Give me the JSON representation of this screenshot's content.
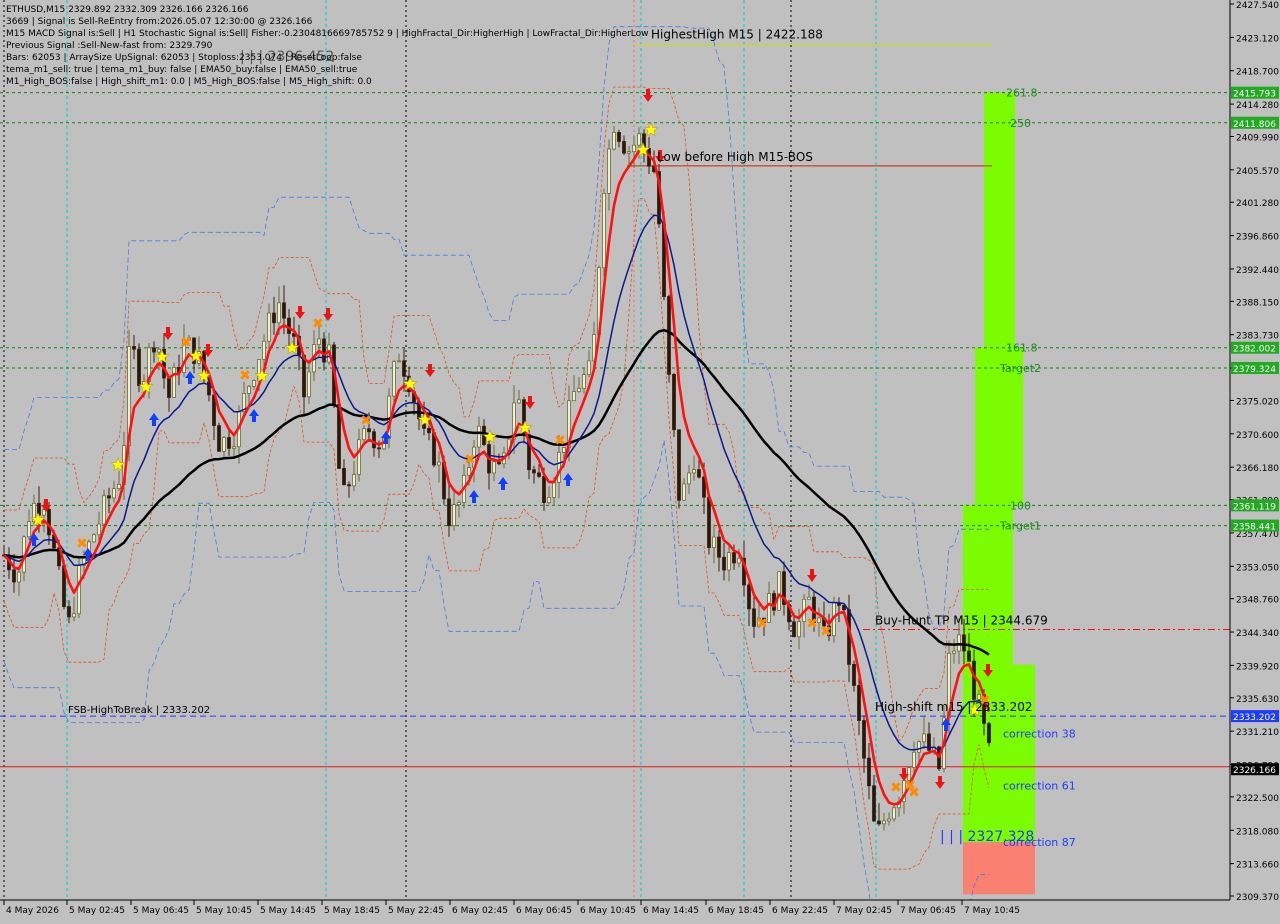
{
  "chart_data": {
    "type": "candlestick",
    "symbol": "ETHUSD",
    "timeframe": "M15",
    "info_lines": [
      "ETHUSD,M15  2329.892 2332.309 2326.166 2326.166",
      "3669  | Signal is Sell-ReEntry from:2026.05.07 12:30:00 @ 2326.166",
      "M15 MACD Signal is:Sell | H1 Stochastic Signal is:Sell| Fisher:-0.2304816669785752 9 | HighFractal_Dir:HigherHigh | LowFractal_Dir:HigherLow",
      "Previous Signal :Sell-New-fast from: 2329.790",
      "Bars: 62053 | ArraySize UpSignal: 62053 | Stoploss:2353.074 | ResetLoop:false",
      "tema_m1_sell: true | tema_m1_buy: false | EMA50_buy:false | EMA50_sell:true",
      "M1_High_BOS:false | High_shift_m1: 0.0 | M5_High_BOS:false | M5_High_shift: 0.0"
    ],
    "y_ticks": [
      "2427.540",
      "2423.120",
      "2418.700",
      "2414.280",
      "2409.990",
      "2405.570",
      "2401.280",
      "2396.860",
      "2392.440",
      "2388.150",
      "2383.730",
      "2379.310",
      "2375.020",
      "2370.600",
      "2366.180",
      "2361.890",
      "2357.470",
      "2353.050",
      "2348.760",
      "2344.340",
      "2339.920",
      "2335.630",
      "2331.210",
      "2326.790",
      "2322.500",
      "2318.080",
      "2313.660",
      "2309.370"
    ],
    "ylim": [
      2309.37,
      2427.54
    ],
    "x_ticks": [
      "4 May 2026",
      "5 May 02:45",
      "5 May 06:45",
      "5 May 10:45",
      "5 May 14:45",
      "5 May 18:45",
      "5 May 22:45",
      "6 May 02:45",
      "6 May 06:45",
      "6 May 10:45",
      "6 May 14:45",
      "6 May 18:45",
      "6 May 22:45",
      "7 May 02:45",
      "7 May 06:45",
      "7 May 10:45"
    ],
    "price_tags": [
      {
        "value": "2415.793",
        "price": 2415.793,
        "color": "#22aa22"
      },
      {
        "value": "2411.806",
        "price": 2411.806,
        "color": "#22aa22"
      },
      {
        "value": "2382.002",
        "price": 2382.002,
        "color": "#22aa22"
      },
      {
        "value": "2379.324",
        "price": 2379.324,
        "color": "#22aa22"
      },
      {
        "value": "2361.119",
        "price": 2361.119,
        "color": "#22aa22"
      },
      {
        "value": "2358.441",
        "price": 2358.441,
        "color": "#22aa22"
      },
      {
        "value": "2333.202",
        "price": 2333.202,
        "color": "#1e3cff"
      },
      {
        "value": "2326.166",
        "price": 2326.166,
        "color": "#000000"
      }
    ],
    "annotations": [
      {
        "text": "HighestHigh   M15 | 2422.188",
        "price": 2422.188
      },
      {
        "text": "Low before High   M15-BOS",
        "price": 2406.1
      },
      {
        "text": "Buy-Hunt  TP M15 | 2344.679",
        "price": 2344.679
      },
      {
        "text": "High-shift m15 | 2333.202",
        "price": 2333.202
      },
      {
        "text": "FSB-HighToBreak | 2333.202",
        "price": 2333.202
      },
      {
        "text": "| | | 2396.452",
        "price": 2420.5
      },
      {
        "text": "| | | 2327.328",
        "price": 2316.5
      }
    ],
    "fib_labels": [
      {
        "text": "261.8",
        "price": 2415.793
      },
      {
        "text": "250",
        "price": 2411.806
      },
      {
        "text": "161.8",
        "price": 2382.002
      },
      {
        "text": "Target2",
        "price": 2379.324
      },
      {
        "text": "100",
        "price": 2361.119
      },
      {
        "text": "Target1",
        "price": 2358.441
      },
      {
        "text": "correction 38",
        "price": 2330.9
      },
      {
        "text": "correction 61",
        "price": 2324.0
      },
      {
        "text": "correction 87",
        "price": 2316.5
      }
    ],
    "colors": {
      "background": "#c0c0c0",
      "bull": "#6b6b3a",
      "bear": "#3a2010",
      "ema_red": "#ff1111",
      "ema_blue": "#0a1a8a",
      "ema_black": "#000000",
      "zone_green": "#7cfc00",
      "zone_red": "#fa8072",
      "green_grid": "#1a7a1a"
    }
  }
}
